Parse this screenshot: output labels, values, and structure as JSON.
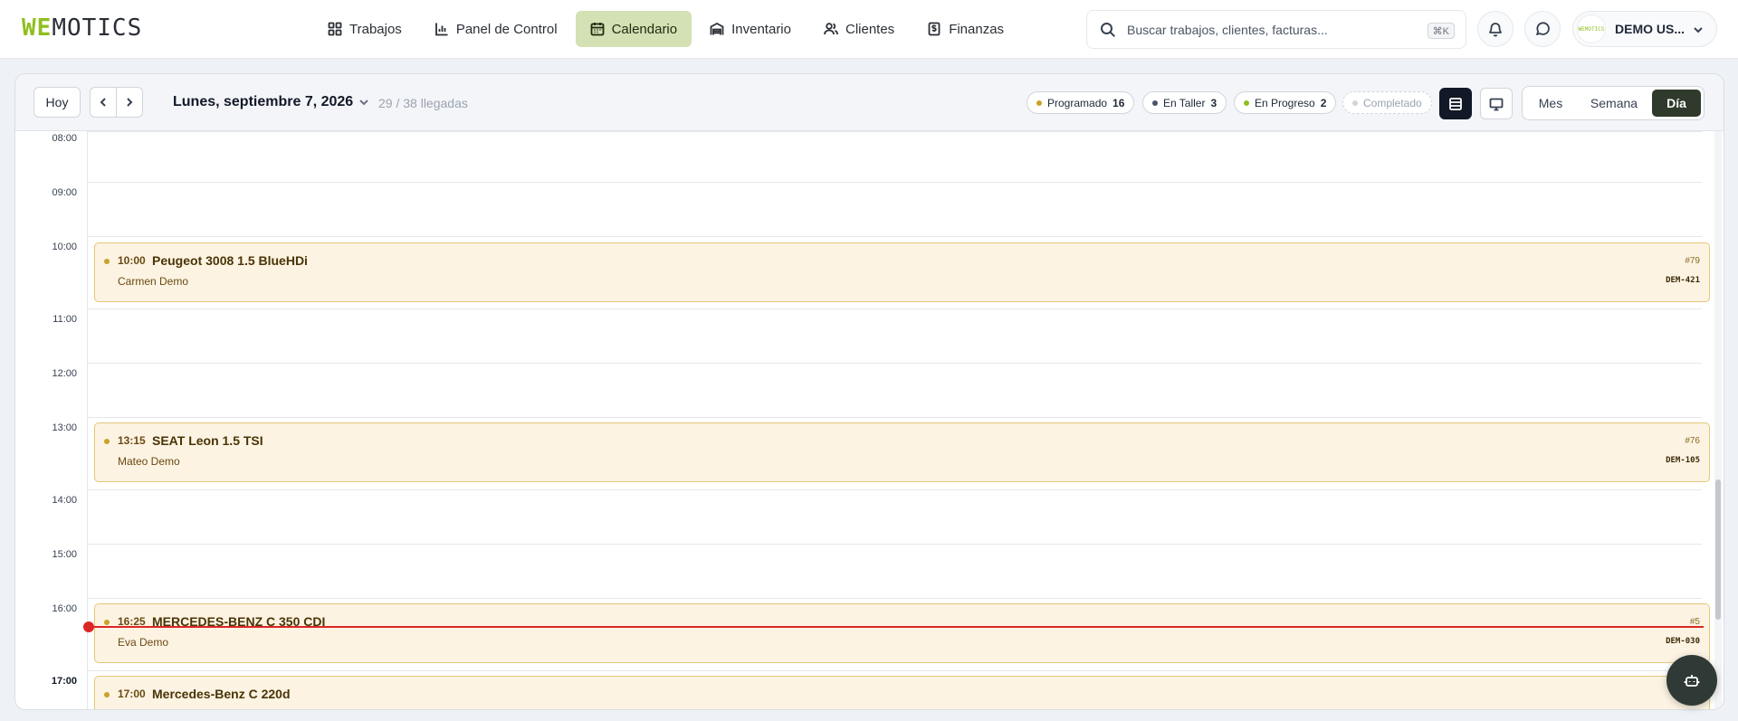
{
  "brand": {
    "logo_part1": "WE",
    "logo_part2": "MOTICS",
    "accent_color": "#8fbf1f"
  },
  "nav": {
    "items": [
      {
        "label": "Trabajos",
        "icon": "grid-icon"
      },
      {
        "label": "Panel de Control",
        "icon": "bar-chart-icon"
      },
      {
        "label": "Calendario",
        "icon": "calendar-icon",
        "active": true
      },
      {
        "label": "Inventario",
        "icon": "warehouse-icon"
      },
      {
        "label": "Clientes",
        "icon": "users-icon"
      },
      {
        "label": "Finanzas",
        "icon": "receipt-dollar-icon"
      }
    ]
  },
  "search": {
    "placeholder": "Buscar trabajos, clientes, facturas...",
    "shortcut": "⌘K"
  },
  "user": {
    "name": "DEMO US...",
    "avatar_text": "WEMOTICS"
  },
  "toolbar": {
    "today_label": "Hoy",
    "date_title": "Lunes, septiembre 7, 2026",
    "arrivals": "29 / 38 llegadas",
    "status_pills": [
      {
        "label": "Programado",
        "count": "16",
        "color": "#c9a227"
      },
      {
        "label": "En Taller",
        "count": "3",
        "color": "#475569"
      },
      {
        "label": "En Progreso",
        "count": "2",
        "color": "#8fbf1f"
      },
      {
        "label": "Completado",
        "count": "",
        "color": "#d1d5db"
      }
    ],
    "views": {
      "month": "Mes",
      "week": "Semana",
      "day": "Día",
      "active": "Día"
    }
  },
  "timeline": {
    "hours": [
      "08:00",
      "09:00",
      "10:00",
      "11:00",
      "12:00",
      "13:00",
      "14:00",
      "15:00",
      "16:00",
      "17:00"
    ],
    "events": [
      {
        "time": "10:00",
        "title": "Peugeot 3008 1.5 BlueHDi",
        "customer": "Carmen Demo",
        "number": "#79",
        "plate": "DEM-421",
        "status": "Programado"
      },
      {
        "time": "13:15",
        "title": "SEAT Leon 1.5 TSI",
        "customer": "Mateo Demo",
        "number": "#76",
        "plate": "DEM-105",
        "status": "Programado"
      },
      {
        "time": "16:25",
        "title": "MERCEDES-BENZ C 350 CDI",
        "customer": "Eva Demo",
        "number": "#5",
        "plate": "DEM-030",
        "status": "Programado"
      },
      {
        "time": "17:00",
        "title": "Mercedes-Benz C 220d",
        "customer": "",
        "number": "",
        "plate": "",
        "status": "Programado"
      }
    ]
  }
}
